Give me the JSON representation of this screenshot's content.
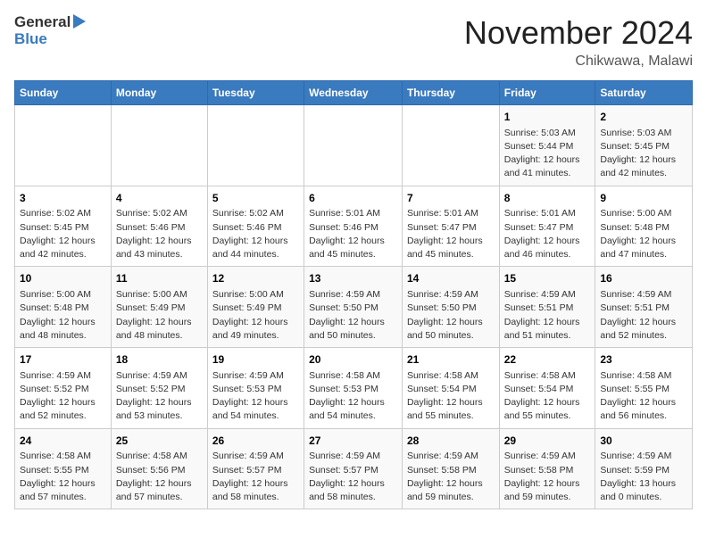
{
  "header": {
    "logo_general": "General",
    "logo_blue": "Blue",
    "month_title": "November 2024",
    "location": "Chikwawa, Malawi"
  },
  "days_of_week": [
    "Sunday",
    "Monday",
    "Tuesday",
    "Wednesday",
    "Thursday",
    "Friday",
    "Saturday"
  ],
  "weeks": [
    [
      {
        "day": "",
        "info": ""
      },
      {
        "day": "",
        "info": ""
      },
      {
        "day": "",
        "info": ""
      },
      {
        "day": "",
        "info": ""
      },
      {
        "day": "",
        "info": ""
      },
      {
        "day": "1",
        "info": "Sunrise: 5:03 AM\nSunset: 5:44 PM\nDaylight: 12 hours and 41 minutes."
      },
      {
        "day": "2",
        "info": "Sunrise: 5:03 AM\nSunset: 5:45 PM\nDaylight: 12 hours and 42 minutes."
      }
    ],
    [
      {
        "day": "3",
        "info": "Sunrise: 5:02 AM\nSunset: 5:45 PM\nDaylight: 12 hours and 42 minutes."
      },
      {
        "day": "4",
        "info": "Sunrise: 5:02 AM\nSunset: 5:46 PM\nDaylight: 12 hours and 43 minutes."
      },
      {
        "day": "5",
        "info": "Sunrise: 5:02 AM\nSunset: 5:46 PM\nDaylight: 12 hours and 44 minutes."
      },
      {
        "day": "6",
        "info": "Sunrise: 5:01 AM\nSunset: 5:46 PM\nDaylight: 12 hours and 45 minutes."
      },
      {
        "day": "7",
        "info": "Sunrise: 5:01 AM\nSunset: 5:47 PM\nDaylight: 12 hours and 45 minutes."
      },
      {
        "day": "8",
        "info": "Sunrise: 5:01 AM\nSunset: 5:47 PM\nDaylight: 12 hours and 46 minutes."
      },
      {
        "day": "9",
        "info": "Sunrise: 5:00 AM\nSunset: 5:48 PM\nDaylight: 12 hours and 47 minutes."
      }
    ],
    [
      {
        "day": "10",
        "info": "Sunrise: 5:00 AM\nSunset: 5:48 PM\nDaylight: 12 hours and 48 minutes."
      },
      {
        "day": "11",
        "info": "Sunrise: 5:00 AM\nSunset: 5:49 PM\nDaylight: 12 hours and 48 minutes."
      },
      {
        "day": "12",
        "info": "Sunrise: 5:00 AM\nSunset: 5:49 PM\nDaylight: 12 hours and 49 minutes."
      },
      {
        "day": "13",
        "info": "Sunrise: 4:59 AM\nSunset: 5:50 PM\nDaylight: 12 hours and 50 minutes."
      },
      {
        "day": "14",
        "info": "Sunrise: 4:59 AM\nSunset: 5:50 PM\nDaylight: 12 hours and 50 minutes."
      },
      {
        "day": "15",
        "info": "Sunrise: 4:59 AM\nSunset: 5:51 PM\nDaylight: 12 hours and 51 minutes."
      },
      {
        "day": "16",
        "info": "Sunrise: 4:59 AM\nSunset: 5:51 PM\nDaylight: 12 hours and 52 minutes."
      }
    ],
    [
      {
        "day": "17",
        "info": "Sunrise: 4:59 AM\nSunset: 5:52 PM\nDaylight: 12 hours and 52 minutes."
      },
      {
        "day": "18",
        "info": "Sunrise: 4:59 AM\nSunset: 5:52 PM\nDaylight: 12 hours and 53 minutes."
      },
      {
        "day": "19",
        "info": "Sunrise: 4:59 AM\nSunset: 5:53 PM\nDaylight: 12 hours and 54 minutes."
      },
      {
        "day": "20",
        "info": "Sunrise: 4:58 AM\nSunset: 5:53 PM\nDaylight: 12 hours and 54 minutes."
      },
      {
        "day": "21",
        "info": "Sunrise: 4:58 AM\nSunset: 5:54 PM\nDaylight: 12 hours and 55 minutes."
      },
      {
        "day": "22",
        "info": "Sunrise: 4:58 AM\nSunset: 5:54 PM\nDaylight: 12 hours and 55 minutes."
      },
      {
        "day": "23",
        "info": "Sunrise: 4:58 AM\nSunset: 5:55 PM\nDaylight: 12 hours and 56 minutes."
      }
    ],
    [
      {
        "day": "24",
        "info": "Sunrise: 4:58 AM\nSunset: 5:55 PM\nDaylight: 12 hours and 57 minutes."
      },
      {
        "day": "25",
        "info": "Sunrise: 4:58 AM\nSunset: 5:56 PM\nDaylight: 12 hours and 57 minutes."
      },
      {
        "day": "26",
        "info": "Sunrise: 4:59 AM\nSunset: 5:57 PM\nDaylight: 12 hours and 58 minutes."
      },
      {
        "day": "27",
        "info": "Sunrise: 4:59 AM\nSunset: 5:57 PM\nDaylight: 12 hours and 58 minutes."
      },
      {
        "day": "28",
        "info": "Sunrise: 4:59 AM\nSunset: 5:58 PM\nDaylight: 12 hours and 59 minutes."
      },
      {
        "day": "29",
        "info": "Sunrise: 4:59 AM\nSunset: 5:58 PM\nDaylight: 12 hours and 59 minutes."
      },
      {
        "day": "30",
        "info": "Sunrise: 4:59 AM\nSunset: 5:59 PM\nDaylight: 13 hours and 0 minutes."
      }
    ]
  ]
}
